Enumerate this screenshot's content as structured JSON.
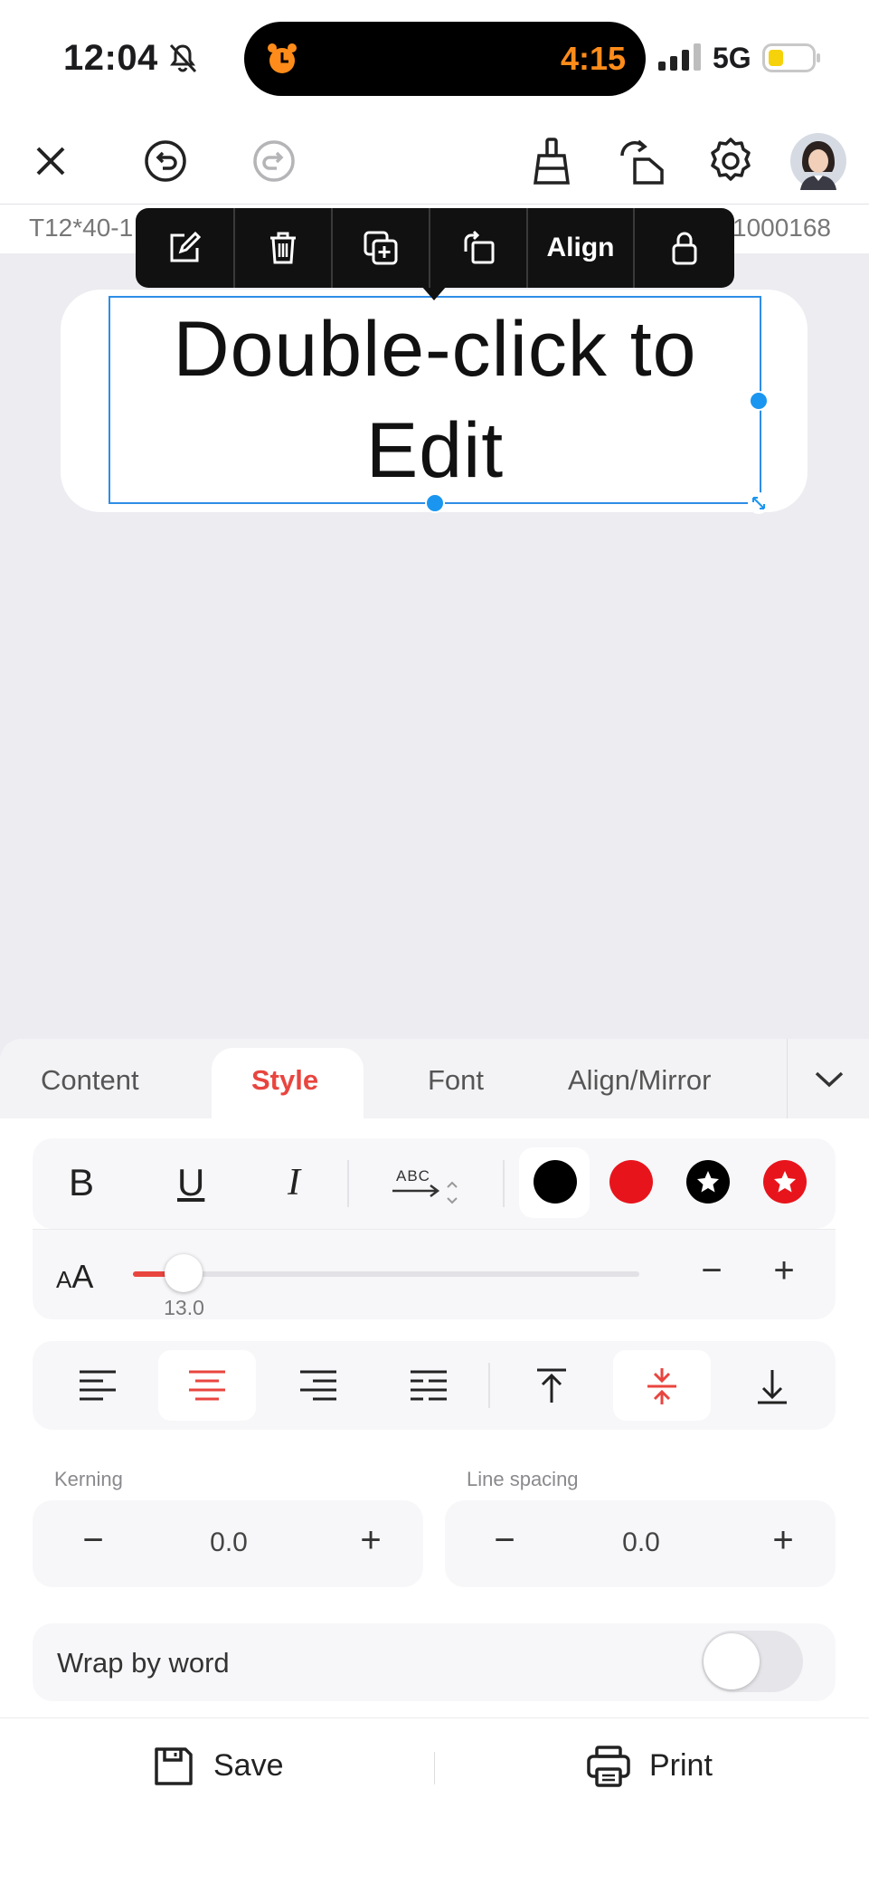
{
  "status_bar": {
    "time": "12:04",
    "timer": "4:15",
    "network": "5G"
  },
  "toolbar": {
    "icons": [
      "close-icon",
      "undo-icon",
      "redo-icon",
      "clear-brush-icon",
      "rotate-icon",
      "gear-icon",
      "avatar"
    ]
  },
  "label_info": {
    "name": "T12*40-1",
    "code": "1000168"
  },
  "context_menu": {
    "align_label": "Align",
    "icons": [
      "edit-icon",
      "trash-icon",
      "duplicate-icon",
      "rotate-element-icon",
      "lock-icon"
    ]
  },
  "canvas": {
    "text_line1": "Double-click to",
    "text_line2": "Edit"
  },
  "tabs": [
    {
      "label": "Content"
    },
    {
      "label": "Style"
    },
    {
      "label": "Font"
    },
    {
      "label": "Align/Mirror"
    }
  ],
  "active_tab": "Style",
  "style": {
    "bold": "B",
    "underline": "U",
    "italic": "I",
    "direction_text": "ABC",
    "colors": [
      "#000000",
      "#e8141c",
      "#000000",
      "#e8141c"
    ],
    "font_size_icon": "AA",
    "font_size_value": "13.0",
    "font_size_fraction": 0.1,
    "minus": "−",
    "plus": "+"
  },
  "kerning": {
    "label": "Kerning",
    "value": "0.0"
  },
  "line_spacing": {
    "label": "Line spacing",
    "value": "0.0"
  },
  "wrap": {
    "label": "Wrap by word",
    "enabled": false
  },
  "actions": {
    "save": "Save",
    "print": "Print"
  },
  "accent_color": "#e9453f",
  "selection_color": "#1a96f0"
}
